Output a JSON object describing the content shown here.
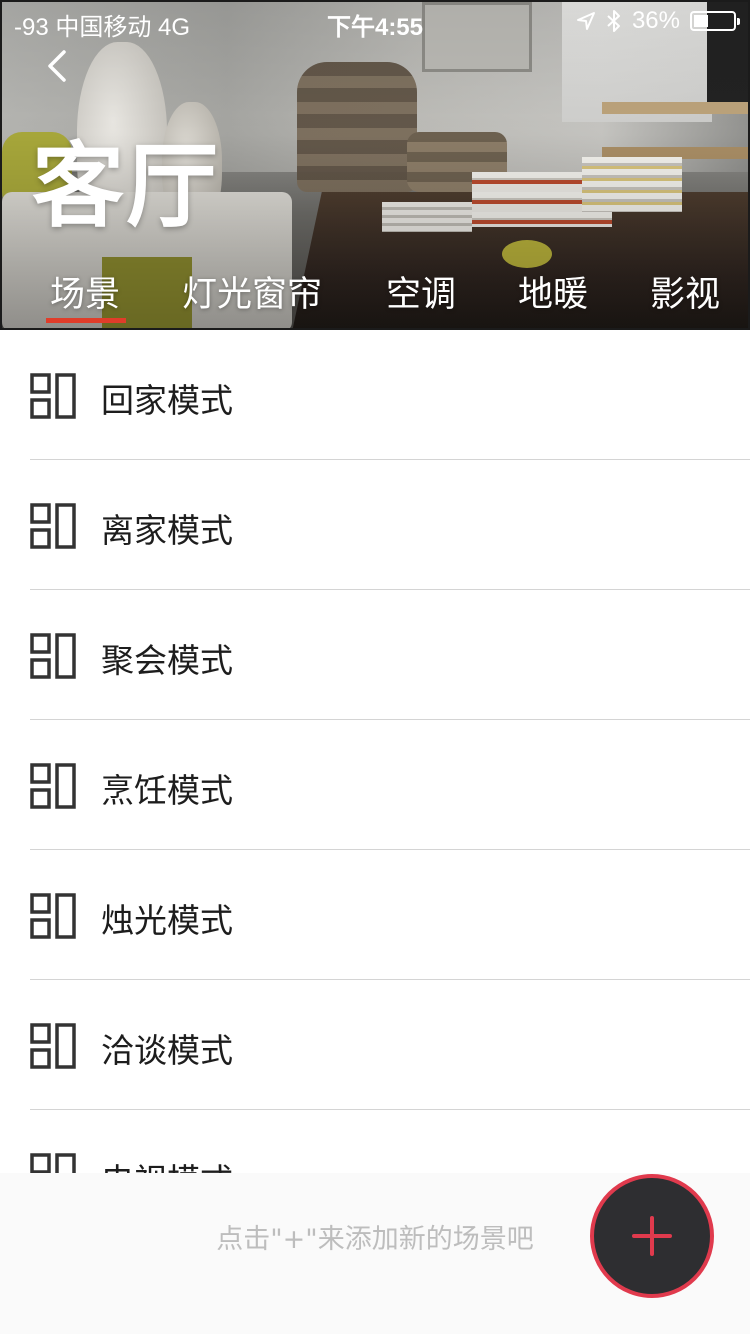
{
  "status_bar": {
    "carrier": "-93 中国移动   4G",
    "time": "下午4:55",
    "battery_percent": "36%",
    "battery_level": 0.36,
    "icons": [
      "location-arrow-icon",
      "bluetooth-icon",
      "battery-icon"
    ]
  },
  "header": {
    "room_title": "客厅",
    "tabs": [
      {
        "label": "场景",
        "active": true
      },
      {
        "label": "灯光窗帘",
        "active": false
      },
      {
        "label": "空调",
        "active": false
      },
      {
        "label": "地暖",
        "active": false
      },
      {
        "label": "影视",
        "active": false
      }
    ],
    "accent_color": "#e03d2a"
  },
  "scenes": [
    {
      "label": "回家模式",
      "icon": "scene-grid-icon"
    },
    {
      "label": "离家模式",
      "icon": "scene-grid-icon"
    },
    {
      "label": "聚会模式",
      "icon": "scene-grid-icon"
    },
    {
      "label": "烹饪模式",
      "icon": "scene-grid-icon"
    },
    {
      "label": "烛光模式",
      "icon": "scene-grid-icon"
    },
    {
      "label": "洽谈模式",
      "icon": "scene-grid-icon"
    },
    {
      "label": "电视模式",
      "icon": "scene-grid-icon"
    }
  ],
  "footer": {
    "hint": "点击\"+\"来添加新的场景吧",
    "add_icon": "plus-icon",
    "fab_ring_color": "#e03a4d",
    "fab_color": "#2e2e31"
  }
}
